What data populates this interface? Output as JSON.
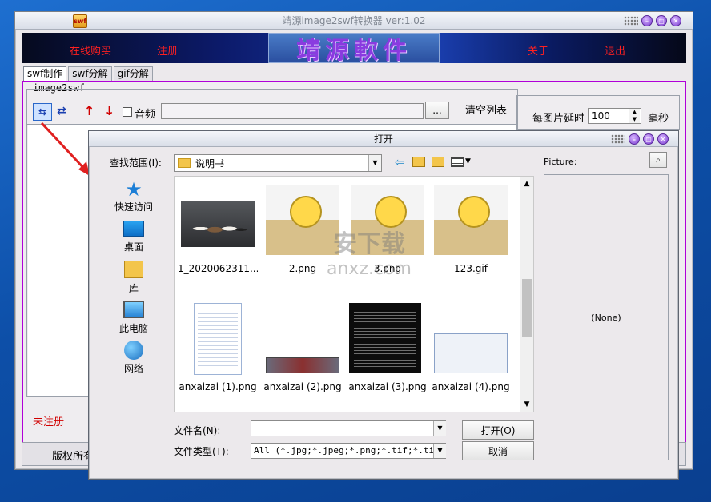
{
  "main_window": {
    "title": "靖源image2swf转换器 ver:1.02",
    "app_icon_text": "swf",
    "banner": {
      "buy_online": "在线购买",
      "register": "注册",
      "logo_text": "靖源軟件",
      "about": "关于",
      "exit": "退出"
    },
    "tabs": [
      {
        "label": "swf制作"
      },
      {
        "label": "swf分解"
      },
      {
        "label": "gif分解"
      }
    ],
    "group_title": "image2swf",
    "toolbar": {
      "audio_label": "音频",
      "browse_label": "...",
      "clear_list_label": "清空列表"
    },
    "delay": {
      "label": "每图片延时",
      "value": "100",
      "unit": "毫秒"
    },
    "status": "未注册",
    "footer": "版权所有"
  },
  "open_dialog": {
    "title": "打开",
    "look_in_label": "查找范围(I):",
    "look_in_value": "说明书",
    "places": [
      {
        "label": "快速访问",
        "icon": "star-icon"
      },
      {
        "label": "桌面",
        "icon": "desktop-icon"
      },
      {
        "label": "库",
        "icon": "library-icon"
      },
      {
        "label": "此电脑",
        "icon": "computer-icon"
      },
      {
        "label": "网络",
        "icon": "network-icon"
      }
    ],
    "files": [
      {
        "name": "1_2020062311...",
        "kind": "puppies"
      },
      {
        "name": "2.png",
        "kind": "cat"
      },
      {
        "name": "3.png",
        "kind": "cat"
      },
      {
        "name": "123.gif",
        "kind": "cat"
      },
      {
        "name": "anxaizai (1).png",
        "kind": "list-window"
      },
      {
        "name": "anxaizai (2).png",
        "kind": "toolbar-strip"
      },
      {
        "name": "anxaizai (3).png",
        "kind": "console"
      },
      {
        "name": "anxaizai (4).png",
        "kind": "dialog"
      }
    ],
    "preview_label": "Picture:",
    "preview_value": "(None)",
    "filename_label": "文件名(N):",
    "filename_value": "",
    "filetype_label": "文件类型(T):",
    "filetype_value": "All (*.jpg;*.jpeg;*.png;*.tif;*.tiff;",
    "open_button": "打开(O)",
    "cancel_button": "取消"
  },
  "watermark": {
    "text": "安下载",
    "subtext": "anxz.com"
  },
  "colors": {
    "accent_magenta": "#b000d8",
    "banner_red": "#ff2020",
    "desktop_blue": "#0d4fa8"
  }
}
